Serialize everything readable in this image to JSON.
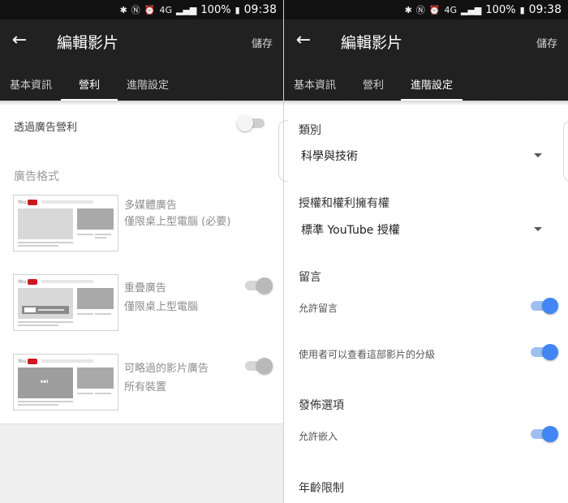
{
  "status_bar": {
    "battery": "100%",
    "time": "09:38",
    "icons": [
      "bluetooth-icon",
      "nfc-icon",
      "alarm-icon",
      "4g-icon",
      "signal-icon",
      "battery-icon"
    ]
  },
  "left": {
    "app_bar": {
      "title": "編輯影片",
      "save": "儲存"
    },
    "tabs": [
      "基本資訊",
      "營利",
      "進階設定"
    ],
    "active_tab": 1,
    "monetize_label": "透過廣告營利",
    "monetize_on": false,
    "ad_formats_heading": "廣告格式",
    "ad_formats": [
      {
        "title": "多媒體廣告",
        "subtitle": "僅限桌上型電腦 (必要)",
        "has_toggle": false
      },
      {
        "title": "重疊廣告",
        "subtitle": "僅限桌上型電腦",
        "has_toggle": true
      },
      {
        "title": "可略過的影片廣告",
        "subtitle": "所有裝置",
        "has_toggle": true
      }
    ],
    "thumb_logo": "You"
  },
  "right": {
    "app_bar": {
      "title": "編輯影片",
      "save": "儲存"
    },
    "tabs": [
      "基本資訊",
      "營利",
      "進階設定"
    ],
    "active_tab": 2,
    "category": {
      "label": "類別",
      "value": "科學與技術"
    },
    "license": {
      "label": "授權和權利擁有權",
      "value": "標準 YouTube 授權"
    },
    "comments": {
      "heading": "留言",
      "allow_comments": {
        "label": "允許留言",
        "on": true
      },
      "show_ratings": {
        "label": "使用者可以查看這部影片的分級",
        "on": true
      }
    },
    "distribution": {
      "heading": "發佈選項",
      "allow_embed": {
        "label": "允許嵌入",
        "on": true
      }
    },
    "age_restriction": {
      "heading": "年齡限制"
    }
  },
  "colors": {
    "bar_dark": "#212121",
    "status_dark": "#111111",
    "toggle_on": "#4285f4",
    "toggle_on_track": "#9ec0f0"
  }
}
